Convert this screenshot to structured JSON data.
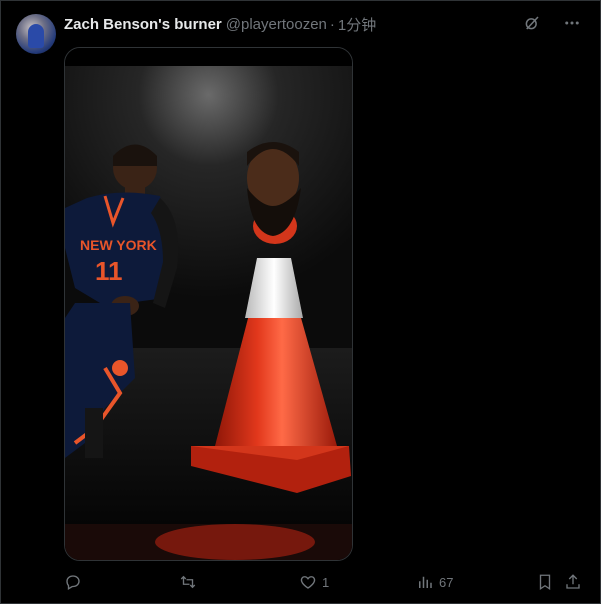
{
  "tweet": {
    "display_name": "Zach Benson's burner",
    "handle": "@playertoozen",
    "separator": "·",
    "timestamp": "1分钟"
  },
  "media": {
    "jersey_text": "NEW YORK",
    "jersey_number": "11"
  },
  "actions": {
    "reply_count": "",
    "retweet_count": "",
    "like_count": "1",
    "view_count": "67"
  },
  "colors": {
    "background": "#000000",
    "text_primary": "#e7e9ea",
    "text_secondary": "#71767b",
    "cone": "#d8321b",
    "jersey": "#0d1a3a",
    "jersey_accent": "#e8552a"
  },
  "icons": [
    "grok-icon",
    "more-icon",
    "reply-icon",
    "retweet-icon",
    "like-icon",
    "views-icon",
    "bookmark-icon",
    "share-icon"
  ]
}
